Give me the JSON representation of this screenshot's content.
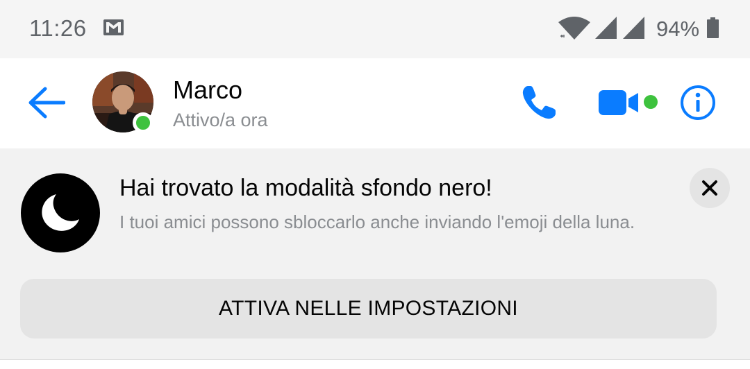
{
  "status_bar": {
    "time": "11:26",
    "battery_percent": "94%",
    "icons": [
      "gmail-icon",
      "wifi-icon",
      "signal-icon",
      "signal-icon",
      "battery-icon"
    ]
  },
  "header": {
    "contact_name": "Marco",
    "contact_status": "Attivo/a ora",
    "icons": [
      "back-arrow-icon",
      "phone-icon",
      "video-camera-icon",
      "info-icon"
    ]
  },
  "banner": {
    "title": "Hai trovato la modalità sfondo nero!",
    "body": "I tuoi amici possono sbloccarlo anche inviando l'emoji della luna.",
    "button_label": "ATTIVA NELLE IMPOSTAZIONI",
    "icons": [
      "moon-icon",
      "close-icon"
    ]
  },
  "colors": {
    "accent": "#0a7cff",
    "presence": "#3ec23e",
    "banner_bg": "#f2f2f2",
    "button_bg": "#e4e4e4"
  }
}
